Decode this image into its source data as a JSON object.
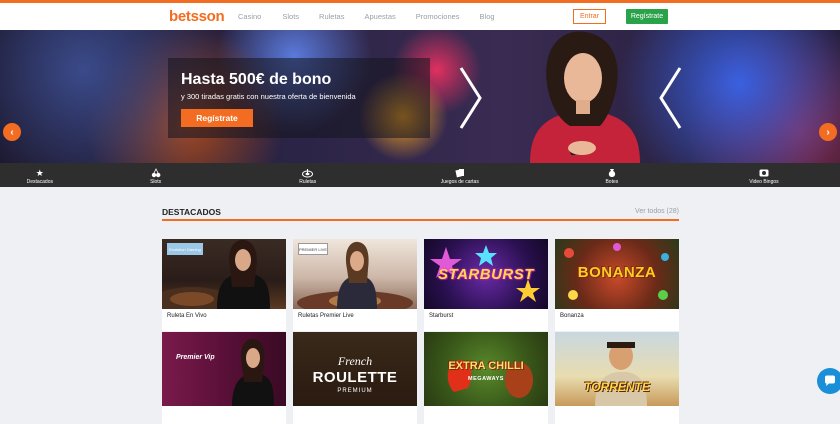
{
  "header": {
    "logo": "betsson",
    "nav": [
      "Casino",
      "Slots",
      "Ruletas",
      "Apuestas",
      "Promociones",
      "Blog"
    ],
    "login_label": "Entrar",
    "register_label": "Regístrate",
    "accent": "#f26d21",
    "green": "#2aa24a"
  },
  "hero": {
    "title": "Hasta 500€ de bono",
    "subtitle": "y 300 tiradas gratis con nuestra oferta de bienvenida",
    "cta": "Regístrate"
  },
  "categories": [
    {
      "label": "Destacados",
      "icon": "star-icon"
    },
    {
      "label": "Slots",
      "icon": "cherries-icon"
    },
    {
      "label": "Ruletas",
      "icon": "roulette-icon"
    },
    {
      "label": "Juegos de cartas",
      "icon": "cards-icon"
    },
    {
      "label": "Botes",
      "icon": "money-bag-icon"
    },
    {
      "label": "Video Bingos",
      "icon": "bingo-icon"
    }
  ],
  "section": {
    "title": "DESTACADOS",
    "see_all": "Ver todos (28)"
  },
  "games": [
    {
      "label": "Ruleta En Vivo",
      "badge": "Evolution Gaming"
    },
    {
      "label": "Ruletas Premier Live",
      "badge": "PREMIER LIVE"
    },
    {
      "label": "Starburst",
      "logo": "STARBURST"
    },
    {
      "label": "Bonanza",
      "logo": "BONANZA"
    }
  ],
  "games_row2": [
    {
      "logo": "Premier Vip"
    },
    {
      "logo_top": "French",
      "logo_main": "ROULETTE",
      "logo_sub": "PREMIUM"
    },
    {
      "logo_main": "EXTRA CHILLI",
      "logo_sub": "MEGAWAYS"
    },
    {
      "logo_main": "TORRENTE"
    }
  ]
}
